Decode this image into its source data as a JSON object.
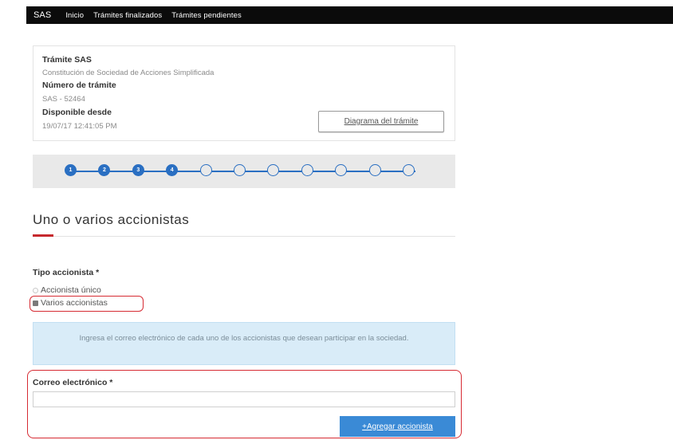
{
  "nav": {
    "brand": "SAS",
    "items": [
      "Inicio",
      "Trámites finalizados",
      "Trámites pendientes"
    ]
  },
  "tramite": {
    "type_label": "Trámite SAS",
    "type_value": "Constitución de Sociedad de Acciones Simplificada",
    "number_label": "Número de trámite",
    "number_value": "SAS - 52464",
    "available_label": "Disponible desde",
    "available_value": "19/07/17 12:41:05 PM",
    "diagram_button": "Diagrama del trámite"
  },
  "stepper": {
    "steps": [
      "1",
      "2",
      "3",
      "4",
      "",
      "",
      "",
      "",
      "",
      "",
      ""
    ],
    "completed": 4,
    "total": 11,
    "accent": "#2a6fc2"
  },
  "section": {
    "title": "Uno o varios accionistas"
  },
  "form": {
    "tipo_label": "Tipo accionista *",
    "options": [
      "Accionista único",
      "Varios accionistas"
    ],
    "selected": "Varios accionistas",
    "info_text": "Ingresa el correo electrónico de cada uno de los accionistas que desean participar en la sociedad.",
    "email_label": "Correo electrónico *",
    "email_value": "",
    "add_button": "+Agregar accionista"
  },
  "colors": {
    "highlight": "#d62b33",
    "primary_button": "#3a8ad6",
    "info_bg": "#d9ecf8"
  }
}
